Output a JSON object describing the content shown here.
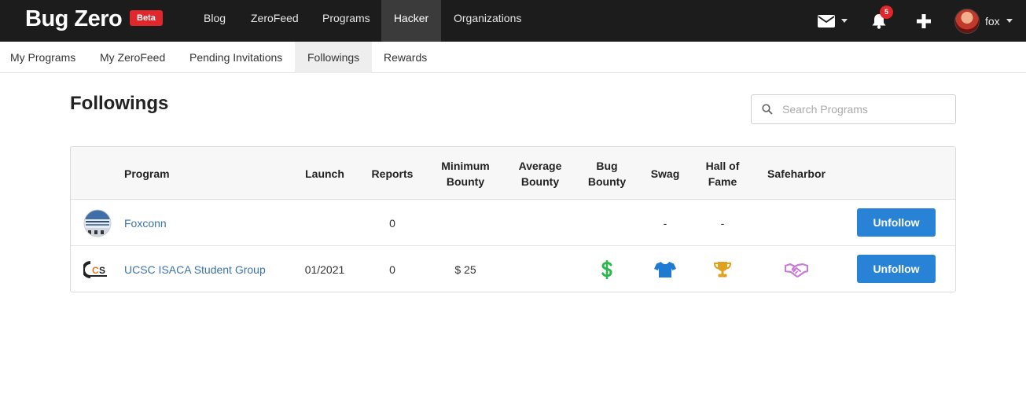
{
  "brand": {
    "name": "Bug Zero",
    "badge": "Beta"
  },
  "topnav": {
    "items": [
      "Blog",
      "ZeroFeed",
      "Programs",
      "Hacker",
      "Organizations"
    ],
    "active": "Hacker",
    "notifications_count": "5",
    "username": "fox"
  },
  "subnav": {
    "items": [
      "My Programs",
      "My ZeroFeed",
      "Pending Invitations",
      "Followings",
      "Rewards"
    ],
    "active": "Followings"
  },
  "page": {
    "title": "Followings",
    "search_placeholder": "Search Programs"
  },
  "table": {
    "headers": {
      "program": "Program",
      "launch": "Launch",
      "reports": "Reports",
      "min_bounty_1": "Minimum",
      "min_bounty_2": "Bounty",
      "avg_bounty_1": "Average",
      "avg_bounty_2": "Bounty",
      "bug_bounty_1": "Bug",
      "bug_bounty_2": "Bounty",
      "swag": "Swag",
      "hof_1": "Hall of",
      "hof_2": "Fame",
      "safeharbor": "Safeharbor"
    },
    "rows": [
      {
        "program": "Foxconn",
        "launch": "",
        "reports": "0",
        "min_bounty": "",
        "avg_bounty": "",
        "bug_bounty": "",
        "swag": "-",
        "hall_of_fame": "-",
        "safeharbor": "",
        "action": "Unfollow"
      },
      {
        "program": "UCSC ISACA Student Group",
        "launch": "01/2021",
        "reports": "0",
        "min_bounty": "$ 25",
        "avg_bounty": "",
        "bug_bounty_icon": "dollar-icon",
        "swag_icon": "tshirt-icon",
        "hall_of_fame_icon": "trophy-icon",
        "safeharbor_icon": "handshake-icon",
        "action": "Unfollow"
      }
    ]
  },
  "colors": {
    "topbar": "#1c1c1c",
    "accent_button": "#2882d6",
    "link": "#3d73ad",
    "badge_red": "#e0272c",
    "dollar_green": "#2db84d",
    "swag_blue": "#1f7bd1",
    "trophy_gold": "#e0a020",
    "handshake_purple": "#c77ad6"
  }
}
